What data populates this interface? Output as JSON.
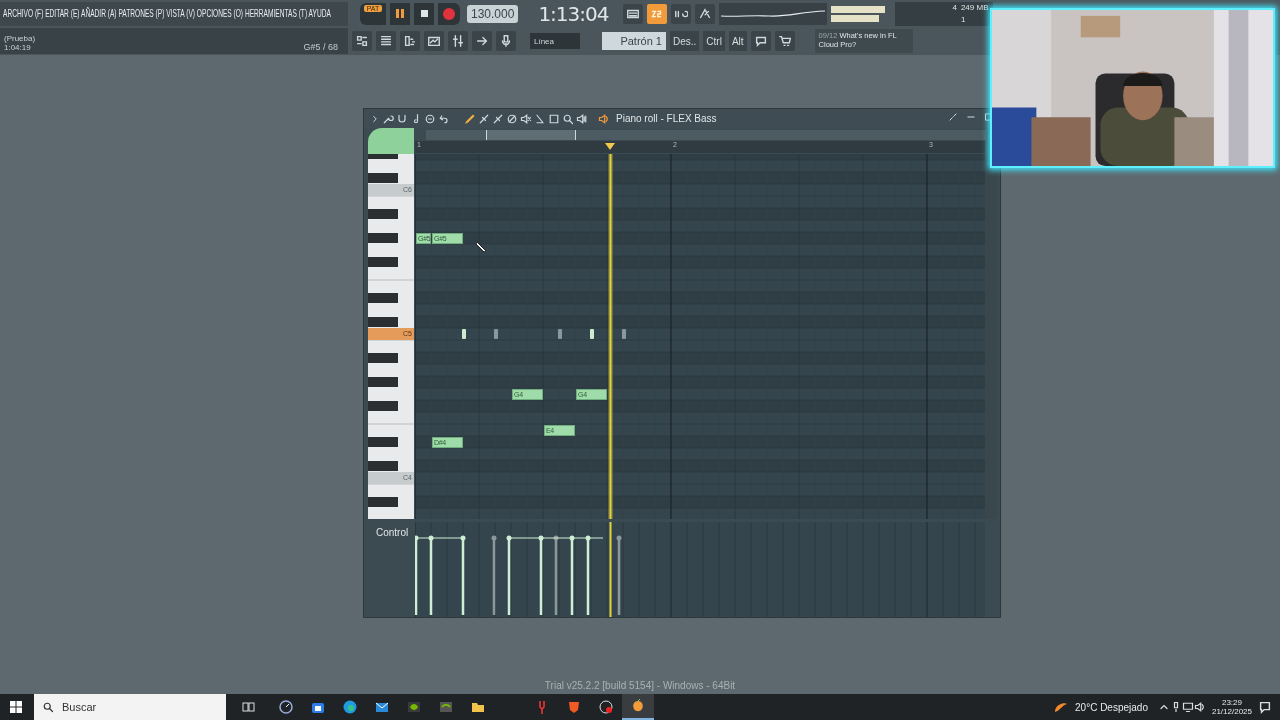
{
  "menu": "ARCHIVO (F) EDITAR (E) AÑADIR (A) PATRONES (P) VISTA (V) OPCIONES (O) HERRAMIENTAS (T) AYUDA",
  "hint": {
    "title": "(Prueba)",
    "value": "1:04:19",
    "note": "G#5 / 68"
  },
  "transport": {
    "mode": "PAT",
    "playing": true,
    "recording": true,
    "tempo": "130.000",
    "time": "1:13:04"
  },
  "step_button": {
    "on": true
  },
  "monitor": {
    "voices": "4",
    "memory": "249 MB",
    "cpu": "1"
  },
  "snap": "Línea",
  "pattern": "Patrón 1",
  "buttons": [
    "Des..",
    "Ctrl",
    "Alt"
  ],
  "news": {
    "date": "09/12",
    "text": "What's new in FL Cloud Pro?"
  },
  "piano_roll": {
    "title": "Piano roll - FLEX Bass",
    "bars": [
      "1",
      "2",
      "3"
    ],
    "keys": [
      {
        "label": "C6",
        "selected": false
      },
      {
        "label": "C5",
        "selected": true
      },
      {
        "label": "C4",
        "selected": false
      }
    ],
    "notes": [
      {
        "label": "G#5"
      },
      {
        "label": "G#5"
      },
      {
        "label": "G4"
      },
      {
        "label": "G4"
      },
      {
        "label": "E4"
      },
      {
        "label": "D#4"
      }
    ],
    "control_label": "Control"
  },
  "footer": "Trial v25.2.2 [build 5154] - Windows - 64Bit",
  "taskbar": {
    "search_placeholder": "Buscar",
    "weather": "20°C Despejado",
    "time": "23:29",
    "date": "21/12/2025"
  }
}
